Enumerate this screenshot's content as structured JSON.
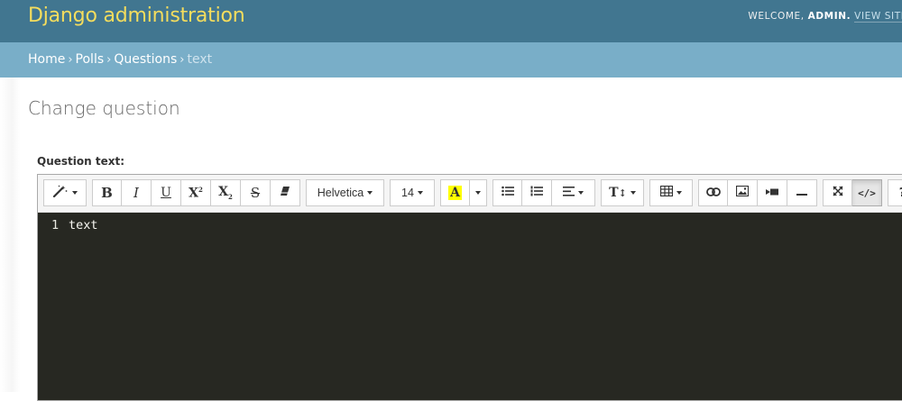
{
  "header": {
    "title": "Django administration",
    "welcome": "WELCOME,",
    "username": "ADMIN.",
    "view_site": "VIEW SITE"
  },
  "breadcrumbs": [
    {
      "label": "Home"
    },
    {
      "label": "Polls"
    },
    {
      "label": "Questions"
    },
    {
      "label": "text"
    }
  ],
  "breadcrumb_separator": "›",
  "page": {
    "title": "Change question",
    "field_label": "Question text:"
  },
  "toolbar": {
    "font_name": "Helvetica",
    "font_size": "14",
    "help_label": "?"
  },
  "editor": {
    "line_numbers": [
      "1"
    ],
    "lines": [
      "text"
    ]
  },
  "colors": {
    "header_bg": "#417690",
    "brand_yellow": "#f5dd5d",
    "breadcrumb_bg": "#79aec8",
    "code_bg": "#272822",
    "highlight_yellow": "#ffff00"
  }
}
